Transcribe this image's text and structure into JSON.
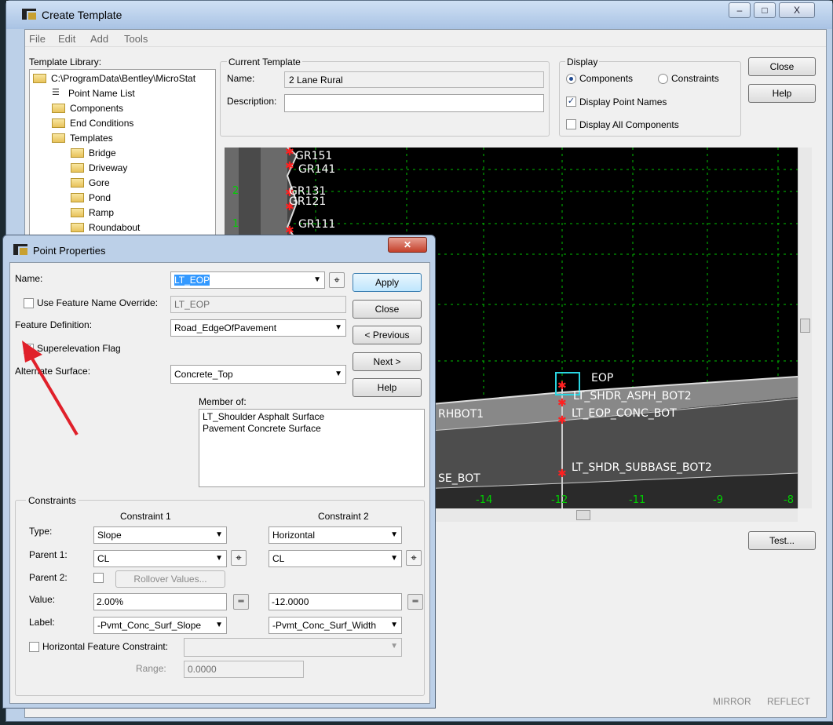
{
  "main_window": {
    "title": "Create Template",
    "menu": [
      "File",
      "Edit",
      "Add",
      "Tools"
    ],
    "controls": {
      "minimize": "–",
      "maximize": "□",
      "close": "X"
    }
  },
  "library": {
    "label": "Template Library:",
    "root": "C:\\ProgramData\\Bentley\\MicroStat",
    "items": [
      "Point Name List",
      "Components",
      "End Conditions",
      "Templates"
    ],
    "templates": [
      "Bridge",
      "Driveway",
      "Gore",
      "Pond",
      "Ramp",
      "Roundabout"
    ]
  },
  "current_template": {
    "group": "Current Template",
    "name_label": "Name:",
    "name_value": "2 Lane Rural",
    "desc_label": "Description:",
    "desc_value": ""
  },
  "display": {
    "group": "Display",
    "components": "Components",
    "constraints": "Constraints",
    "selected": "components",
    "display_point_names": "Display Point Names",
    "display_point_names_checked": true,
    "display_all_components": "Display All Components",
    "display_all_components_checked": false
  },
  "right_buttons": {
    "close": "Close",
    "help": "Help",
    "test": "Test..."
  },
  "canvas": {
    "left_points": [
      "GR151",
      "GR141",
      "GR131",
      "GR121",
      "GR111"
    ],
    "y_ticks": [
      "2",
      "1"
    ],
    "right_points": [
      "EOP",
      "LT_SHDR_ASPH_BOT2",
      "LT_EOP_CONC_BOT",
      "LT_SHDR_SUBBASE_BOT2"
    ],
    "overlap_left_labels": [
      "RHBOT1",
      "SE_BOT"
    ],
    "x_ticks": [
      "-14",
      "-12",
      "-11",
      "-9",
      "-8"
    ],
    "footer": {
      "mirror": "MIRROR",
      "reflect": "REFLECT"
    }
  },
  "point_properties": {
    "title": "Point Properties",
    "name_label": "Name:",
    "name_value": "LT_EOP",
    "use_override_label": "Use Feature Name Override:",
    "use_override_checked": false,
    "override_value": "LT_EOP",
    "feature_def_label": "Feature Definition:",
    "feature_def_value": "Road_EdgeOfPavement",
    "superelevation_label": "Superelevation Flag",
    "superelevation_checked": true,
    "alt_surface_label": "Alternate Surface:",
    "alt_surface_value": "Concrete_Top",
    "member_of_label": "Member of:",
    "member_of": [
      "LT_Shoulder Asphalt Surface",
      "Pavement Concrete Surface"
    ],
    "buttons": {
      "apply": "Apply",
      "close": "Close",
      "previous": "< Previous",
      "next": "Next >",
      "help": "Help"
    },
    "constraints": {
      "group": "Constraints",
      "c1_header": "Constraint 1",
      "c2_header": "Constraint 2",
      "type_label": "Type:",
      "parent1_label": "Parent 1:",
      "parent2_label": "Parent 2:",
      "value_label": "Value:",
      "label_label": "Label:",
      "c1": {
        "type": "Slope",
        "parent1": "CL",
        "value": "2.00%",
        "label": "-Pvmt_Conc_Surf_Slope"
      },
      "c2": {
        "type": "Horizontal",
        "parent1": "CL",
        "value": "-12.0000",
        "label": "-Pvmt_Conc_Surf_Width"
      },
      "rollover": "Rollover Values...",
      "hfc_label": "Horizontal Feature Constraint:",
      "range_label": "Range:",
      "range_value": "0.0000"
    }
  },
  "colors": {
    "annotation_arrow": "#e0202a",
    "grid": "#00c000",
    "selection": "#2ad4e0",
    "point_marker": "#ff2020"
  }
}
